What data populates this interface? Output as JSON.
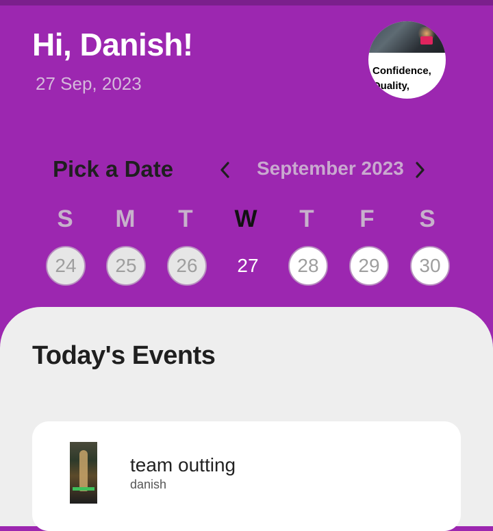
{
  "header": {
    "greeting": "Hi, Danish!",
    "date": "27 Sep, 2023",
    "avatar_caption": "Confidence, Quality,"
  },
  "calendar": {
    "title": "Pick a Date",
    "month_label": "September 2023",
    "weekdays": [
      "S",
      "M",
      "T",
      "W",
      "T",
      "F",
      "S"
    ],
    "active_weekday_index": 3,
    "days": [
      "24",
      "25",
      "26",
      "27",
      "28",
      "29",
      "30"
    ],
    "selected_day": "27",
    "prev_icon": "chevron-left-icon",
    "next_icon": "chevron-right-icon"
  },
  "events": {
    "title": "Today's Events",
    "items": [
      {
        "name": "team outting",
        "owner": "danish"
      }
    ]
  },
  "colors": {
    "background": "#9c27b0",
    "panel": "#eeeeee",
    "card": "#ffffff"
  }
}
